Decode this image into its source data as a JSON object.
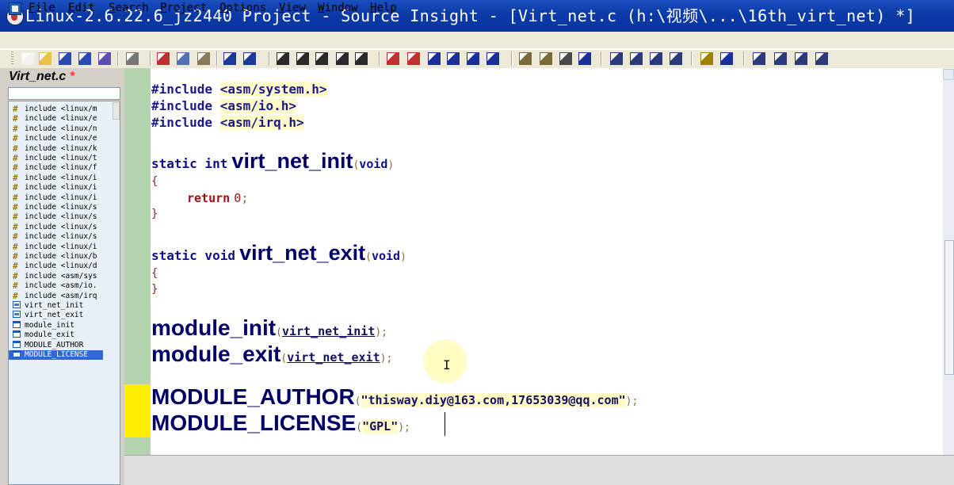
{
  "window": {
    "title": "Linux-2.6.22.6_jz2440 Project - Source Insight - [Virt_net.c (h:\\视频\\...\\16th_virt_net) *]"
  },
  "menu": [
    "File",
    "Edit",
    "Search",
    "Project",
    "Options",
    "View",
    "Window",
    "Help"
  ],
  "toolbar": {
    "buttons": [
      "new-file-icon",
      "open-file-icon",
      "save-icon",
      "save-all-icon",
      "close-file-icon",
      "print-icon",
      "cut-icon",
      "copy-icon",
      "paste-icon",
      "undo-icon",
      "redo-icon",
      "search-icon",
      "search-files-icon",
      "search-project-icon",
      "replace-icon",
      "lookup-references-icon",
      "bookmark-icon",
      "bookmark-list-icon",
      "back-icon",
      "forward-icon",
      "jump-icon",
      "jump-list-icon",
      "project-window-icon",
      "symbol-window-icon",
      "context-window-icon",
      "relation-window-icon",
      "tile-horizontal-icon",
      "tile-vertical-icon",
      "tile-one-icon",
      "cascade-icon",
      "symbol-info-icon",
      "select-icon",
      "lock-icon",
      "browse-icon",
      "tree-icon",
      "help-icon"
    ]
  },
  "symbol_window": {
    "file_title": "Virt_net.c",
    "modified_mark": "*",
    "items": [
      {
        "label": "include <linux/m",
        "kind": "include"
      },
      {
        "label": "include <linux/e",
        "kind": "include"
      },
      {
        "label": "include <linux/n",
        "kind": "include"
      },
      {
        "label": "include <linux/e",
        "kind": "include"
      },
      {
        "label": "include <linux/k",
        "kind": "include"
      },
      {
        "label": "include <linux/t",
        "kind": "include"
      },
      {
        "label": "include <linux/f",
        "kind": "include"
      },
      {
        "label": "include <linux/i",
        "kind": "include"
      },
      {
        "label": "include <linux/i",
        "kind": "include"
      },
      {
        "label": "include <linux/i",
        "kind": "include"
      },
      {
        "label": "include <linux/s",
        "kind": "include"
      },
      {
        "label": "include <linux/s",
        "kind": "include"
      },
      {
        "label": "include <linux/s",
        "kind": "include"
      },
      {
        "label": "include <linux/s",
        "kind": "include"
      },
      {
        "label": "include <linux/i",
        "kind": "include"
      },
      {
        "label": "include <linux/b",
        "kind": "include"
      },
      {
        "label": "include <linux/d",
        "kind": "include"
      },
      {
        "label": "include <asm/sys",
        "kind": "include"
      },
      {
        "label": "include <asm/io.",
        "kind": "include"
      },
      {
        "label": "include <asm/irq",
        "kind": "include"
      },
      {
        "label": "virt_net_init",
        "kind": "function"
      },
      {
        "label": "virt_net_exit",
        "kind": "function"
      },
      {
        "label": "module_init",
        "kind": "macro"
      },
      {
        "label": "module_exit",
        "kind": "macro"
      },
      {
        "label": "MODULE_AUTHOR",
        "kind": "macro"
      },
      {
        "label": "MODULE_LICENSE",
        "kind": "macro",
        "selected": true
      }
    ]
  },
  "code": {
    "includes": [
      {
        "directive": "#include",
        "path": "<asm/system.h>"
      },
      {
        "directive": "#include",
        "path": "<asm/io.h>"
      },
      {
        "directive": "#include",
        "path": "<asm/irq.h>"
      }
    ],
    "init_fn": {
      "qualifiers": "static int",
      "name": "virt_net_init",
      "param": "void",
      "open": "(",
      "close": ")",
      "brace_open": "{",
      "return_kw": "return",
      "return_val": "0",
      "semi": ";",
      "brace_close": "}"
    },
    "exit_fn": {
      "qualifiers": "static void",
      "name": "virt_net_exit",
      "param": "void",
      "open": "(",
      "close": ")",
      "brace_open": "{",
      "brace_close": "}"
    },
    "module_init": {
      "macro": "module_init",
      "arg": "virt_net_init",
      "open": "(",
      "close": ");"
    },
    "module_exit": {
      "macro": "module_exit",
      "arg": "virt_net_exit",
      "open": "(",
      "close": ");"
    },
    "module_author": {
      "macro": "MODULE_AUTHOR",
      "arg": "\"thisway.diy@163.com,17653039@qq.com\"",
      "open": "(",
      "close": ");"
    },
    "module_license": {
      "macro": "MODULE_LICENSE",
      "arg": "\"GPL\"",
      "open": "(",
      "close": ");"
    }
  },
  "colors": {
    "titlebar": "#0b3aa6",
    "gutter": "#b5d3af",
    "gutter_mark": "#ffee00",
    "selection": "#3168d5"
  }
}
